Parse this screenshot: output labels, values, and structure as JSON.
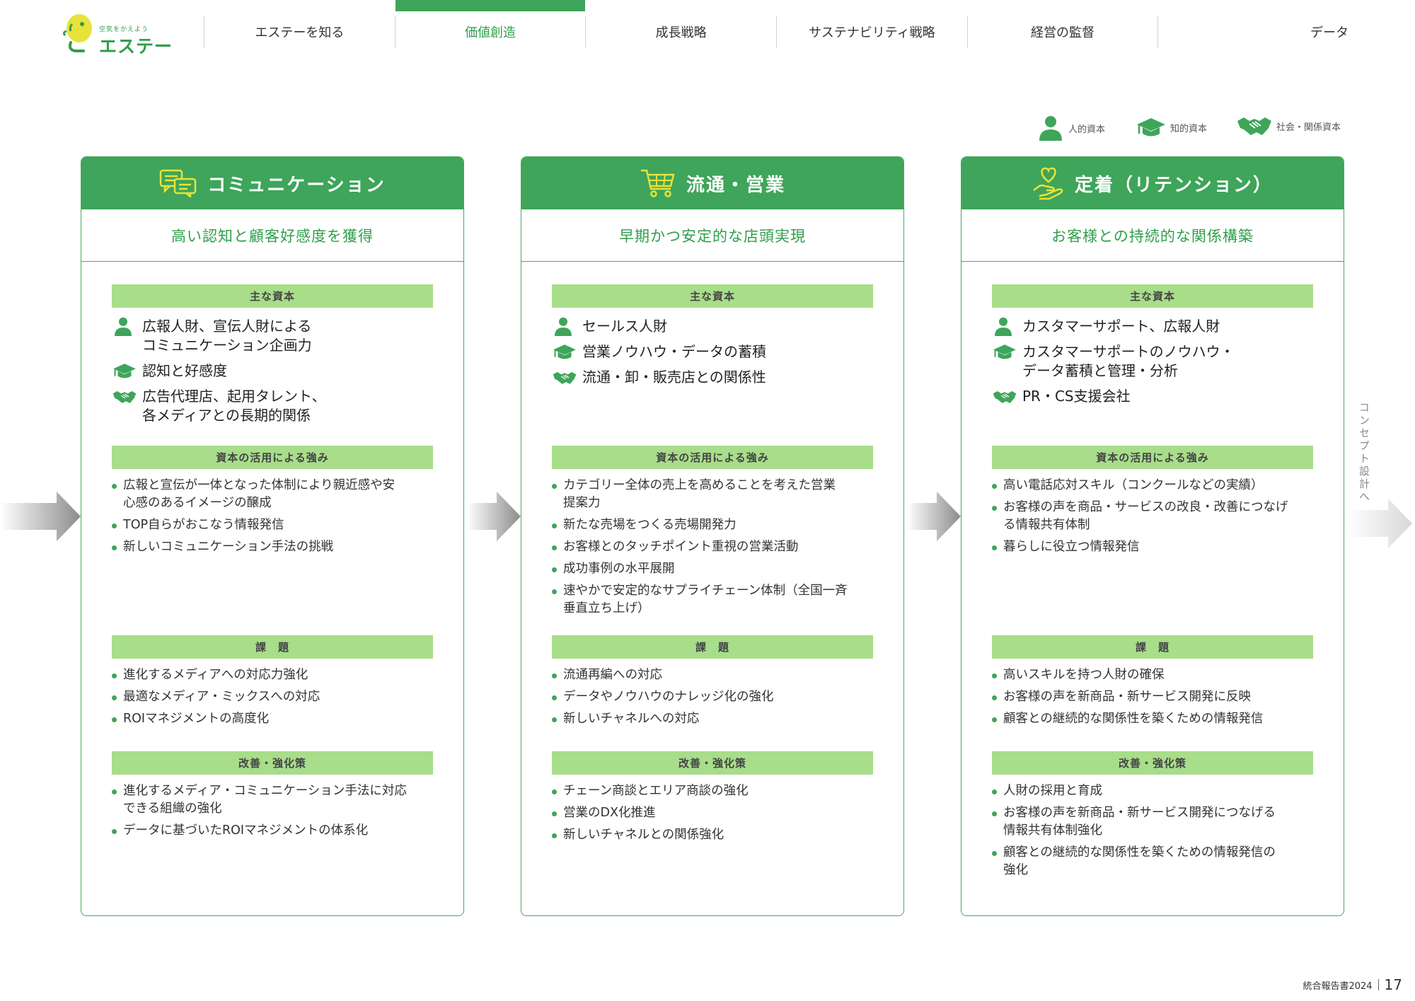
{
  "header": {
    "logo_tagline": "空気をかえよう",
    "logo_name": "エステー",
    "nav": [
      {
        "label": "エステーを知る",
        "active": false
      },
      {
        "label": "価値創造",
        "active": true
      },
      {
        "label": "成長戦略",
        "active": false
      },
      {
        "label": "サステナビリティ戦略",
        "active": false
      },
      {
        "label": "経営の監督",
        "active": false
      },
      {
        "label": "データ",
        "active": false
      }
    ]
  },
  "legend": {
    "human": "人的資本",
    "intellectual": "知的資本",
    "social": "社会・関係資本"
  },
  "section_labels": {
    "capital": "主な資本",
    "strengths": "資本の活用による強み",
    "issues": "課　題",
    "measures": "改善・強化策"
  },
  "cards": [
    {
      "title": "コミュニケーション",
      "subtitle": "高い認知と顧客好感度を獲得",
      "capitals": [
        {
          "icon": "person-icon",
          "text": "広報人財、宣伝人財による\nコミュニケーション企画力"
        },
        {
          "icon": "graduation-cap-icon",
          "text": "認知と好感度"
        },
        {
          "icon": "handshake-icon",
          "text": "広告代理店、起用タレント、\n各メディアとの長期的関係"
        }
      ],
      "strengths": [
        "広報と宣伝が一体となった体制により親近感や安\n心感のあるイメージの醸成",
        "TOP自らがおこなう情報発信",
        "新しいコミュニケーション手法の挑戦"
      ],
      "issues": [
        "進化するメディアへの対応力強化",
        "最適なメディア・ミックスへの対応",
        "ROIマネジメントの高度化"
      ],
      "measures": [
        "進化するメディア・コミュニケーション手法に対応\nできる組織の強化",
        "データに基づいたROIマネジメントの体系化"
      ]
    },
    {
      "title": "流通・営業",
      "subtitle": "早期かつ安定的な店頭実現",
      "capitals": [
        {
          "icon": "person-icon",
          "text": "セールス人財"
        },
        {
          "icon": "graduation-cap-icon",
          "text": "営業ノウハウ・データの蓄積"
        },
        {
          "icon": "handshake-icon",
          "text": "流通・卸・販売店との関係性"
        }
      ],
      "strengths": [
        "カテゴリー全体の売上を高めることを考えた営業\n提案力",
        "新たな売場をつくる売場開発力",
        "お客様とのタッチポイント重視の営業活動",
        "成功事例の水平展開",
        "速やかで安定的なサプライチェーン体制（全国一斉\n垂直立ち上げ）"
      ],
      "issues": [
        "流通再編への対応",
        "データやノウハウのナレッジ化の強化",
        "新しいチャネルへの対応"
      ],
      "measures": [
        "チェーン商談とエリア商談の強化",
        "営業のDX化推進",
        "新しいチャネルとの関係強化"
      ]
    },
    {
      "title": "定着（リテンション）",
      "subtitle": "お客様との持続的な関係構築",
      "capitals": [
        {
          "icon": "person-icon",
          "text": "カスタマーサポート、広報人財"
        },
        {
          "icon": "graduation-cap-icon",
          "text": "カスタマーサポートのノウハウ・\nデータ蓄積と管理・分析"
        },
        {
          "icon": "handshake-icon",
          "text": "PR・CS支援会社"
        }
      ],
      "strengths": [
        "高い電話応対スキル（コンクールなどの実績）",
        "お客様の声を商品・サービスの改良・改善につなげ\nる情報共有体制",
        "暮らしに役立つ情報発信"
      ],
      "issues": [
        "高いスキルを持つ人財の確保",
        "お客様の声を新商品・新サービス開発に反映",
        "顧客との継続的な関係性を築くための情報発信"
      ],
      "measures": [
        "人財の採用と育成",
        "お客様の声を新商品・新サービス開発につなげる\n情報共有体制強化",
        "顧客との継続的な関係性を築くための情報発信の\n強化"
      ]
    }
  ],
  "side_label": "コンセプト設計へ",
  "footer": {
    "report": "統合報告書2024",
    "page": "17"
  },
  "colors": {
    "accent": "#3ea55a",
    "bar": "#a8dd8a",
    "logo_yellow": "#e8e33a"
  }
}
